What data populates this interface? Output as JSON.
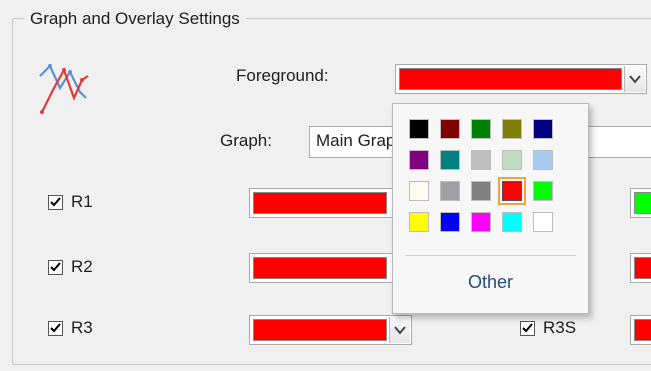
{
  "group": {
    "title": "Graph and Overlay Settings"
  },
  "icon": {
    "name": "graph-icon"
  },
  "foreground": {
    "label": "Foreground:",
    "color": "#ff0000"
  },
  "graph": {
    "label": "Graph:",
    "value": "Main Graph"
  },
  "rows": [
    {
      "label": "R1",
      "checked": true,
      "color": "#ff0000"
    },
    {
      "label": "R2",
      "checked": true,
      "color": "#ff0000"
    },
    {
      "label": "R3",
      "checked": true,
      "color": "#ff0000"
    }
  ],
  "right_rows": [
    {
      "label": "",
      "color": "#00ff00"
    },
    {
      "label": "",
      "color": "#ff0000"
    },
    {
      "label": "R3S",
      "checked": true,
      "color": "#ff0000"
    }
  ],
  "palette": {
    "colors": [
      "#000000",
      "#800000",
      "#008000",
      "#808000",
      "#000080",
      "#800080",
      "#008080",
      "#c0c0c0",
      "#c0dcc0",
      "#a6caf0",
      "#fffbf0",
      "#a0a0a4",
      "#808080",
      "#ff0000",
      "#00ff00",
      "#ffff00",
      "#0000ff",
      "#ff00ff",
      "#00ffff",
      "#ffffff"
    ],
    "selected_index": 13,
    "other_label": "Other"
  }
}
